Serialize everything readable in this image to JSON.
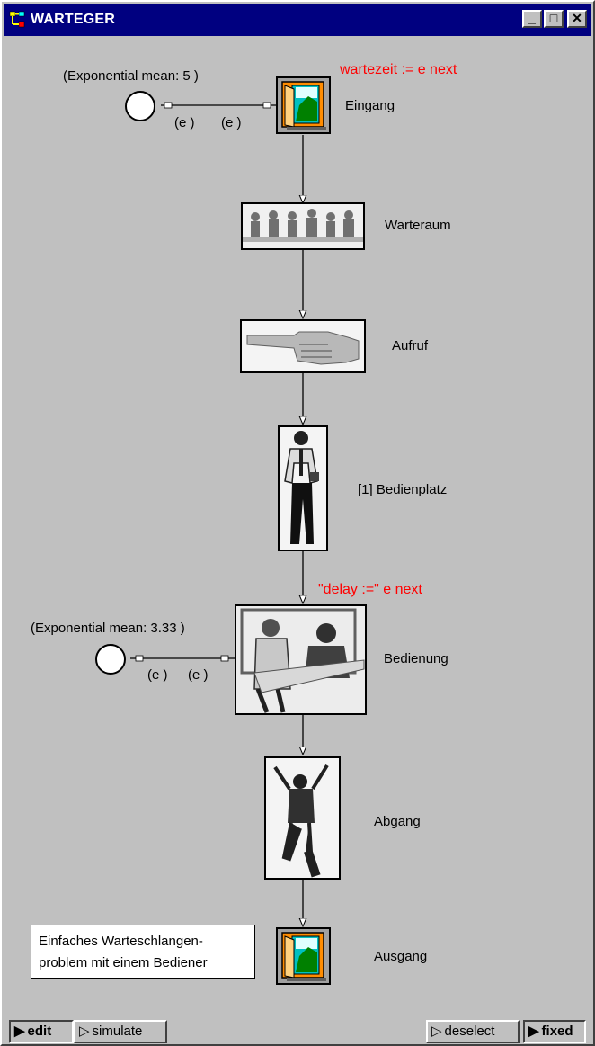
{
  "window": {
    "title": "WARTEGER"
  },
  "title_buttons": {
    "minimize": "_",
    "maximize": "□",
    "close": "✕"
  },
  "model": {
    "generator1": {
      "label": "(Exponential mean: 5 )",
      "port_left": "(e )",
      "port_right": "(e )"
    },
    "eingang": {
      "label": "Eingang",
      "annotation": "wartezeit := e next"
    },
    "warteraum": {
      "label": "Warteraum"
    },
    "aufruf": {
      "label": "Aufruf"
    },
    "bedienplatz": {
      "label": "[1] Bedienplatz"
    },
    "generator2": {
      "label": "(Exponential mean: 3.33 )",
      "port_left": "(e )",
      "port_right": "(e )"
    },
    "bedienung": {
      "label": "Bedienung",
      "annotation": "\"delay :=\" e next"
    },
    "abgang": {
      "label": "Abgang"
    },
    "ausgang": {
      "label": "Ausgang"
    },
    "comment": {
      "line1": "Einfaches Warteschlangen-",
      "line2": "problem mit einem Bediener"
    }
  },
  "statusbar": {
    "edit": "edit",
    "simulate": "simulate",
    "deselect": "deselect",
    "fixed": "fixed"
  }
}
